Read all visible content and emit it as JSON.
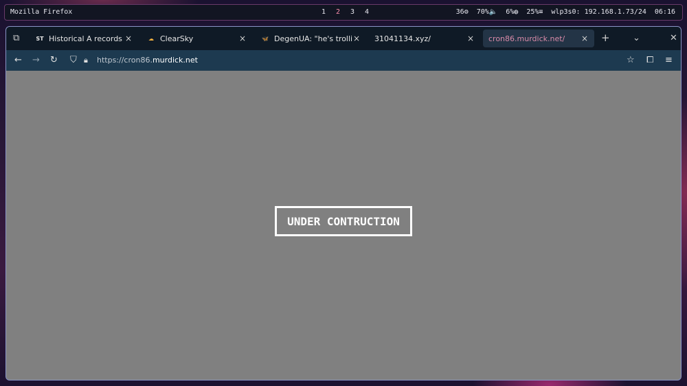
{
  "topbar": {
    "app_title": "Mozilla Firefox",
    "workspaces": [
      "1",
      "2",
      "3",
      "4"
    ],
    "active_workspace": "2",
    "status": {
      "cpu": "36",
      "volume": "70%",
      "disk": "6%",
      "memory": "25%",
      "network": "wlp3s0: 192.168.1.73/24",
      "clock": "06:16"
    }
  },
  "tabs": [
    {
      "favicon": "ST",
      "label": "Historical A records for m",
      "active": false
    },
    {
      "favicon": "clearsky-icon",
      "label": "ClearSky",
      "active": false
    },
    {
      "favicon": "bluesky-butterfly-icon",
      "label": "DegenUA: \"he's trolling. t",
      "active": false
    },
    {
      "favicon": "",
      "label": "31041134.xyz/",
      "active": false
    },
    {
      "favicon": "",
      "label": "cron86.murdick.net/",
      "active": true
    }
  ],
  "navbar": {
    "url_prefix": "https://cron86.",
    "url_host": "murdick.net"
  },
  "page": {
    "banner_text": "UNDER CONTRUCTION"
  },
  "colors": {
    "page_background": "#808080",
    "tabbar": "#0f1a26",
    "navbar": "#1d3a50",
    "active_tab_text": "#d98aa8"
  }
}
